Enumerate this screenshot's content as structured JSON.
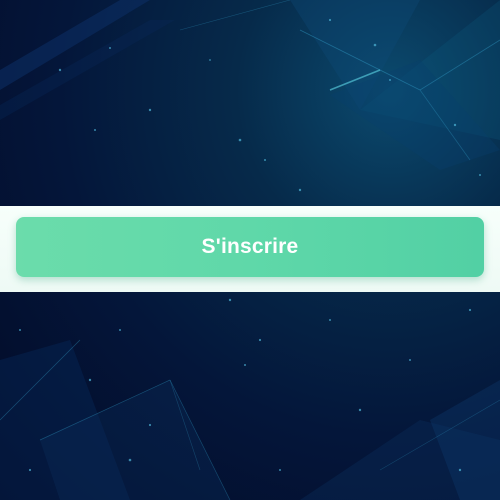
{
  "signup": {
    "button_label": "S'inscrire"
  },
  "colors": {
    "background_dark": "#020a26",
    "background_glow": "#0b4a6e",
    "band": "#f2fcf8",
    "button": "#5fd8a9",
    "button_text": "#ffffff"
  },
  "icons": [
    "background-polygon-art"
  ]
}
